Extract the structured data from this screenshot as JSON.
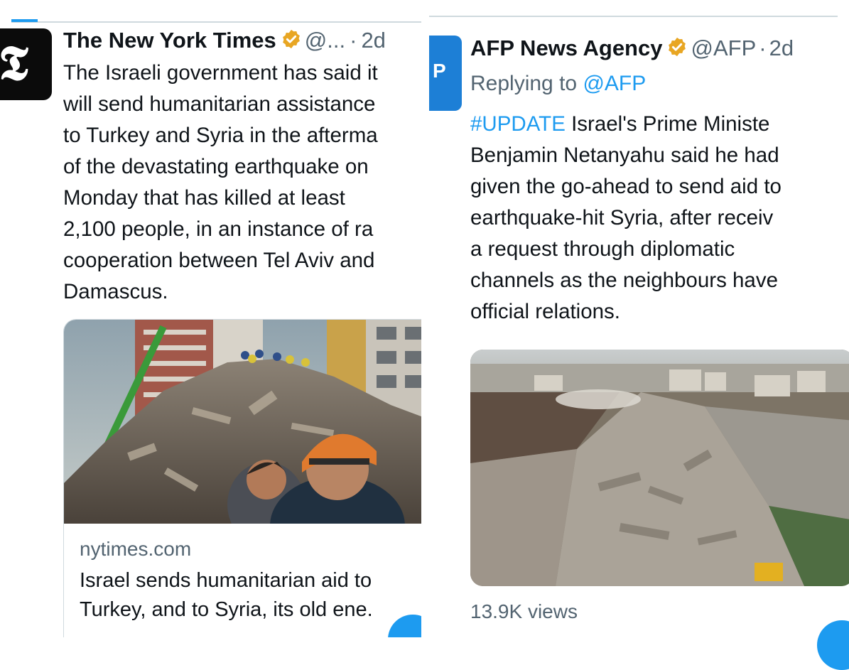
{
  "left_tweet": {
    "author_name": "The New York Times",
    "handle": "@...",
    "separator": "·",
    "time": "2d",
    "avatar_glyph": "𝕿",
    "body_lines": [
      "The Israeli government has said it",
      "will send humanitarian assistance",
      "to Turkey and Syria in the afterma",
      "of the devastating earthquake on",
      "Monday that has killed at least",
      "2,100 people, in an instance of ra",
      "cooperation between Tel Aviv and",
      "Damascus."
    ],
    "card": {
      "domain": "nytimes.com",
      "title_lines": [
        "Israel sends humanitarian aid to",
        "Turkey, and to Syria, its old ene."
      ]
    }
  },
  "right_tweet": {
    "author_name": "AFP News Agency",
    "handle": "@AFP",
    "separator": "·",
    "time": "2d",
    "avatar_glyph": "P",
    "replying_prefix": "Replying to",
    "replying_mention": "@AFP",
    "hashtag": "#UPDATE",
    "body_first_rest": " Israel's Prime Ministe",
    "body_lines": [
      "Benjamin Netanyahu said he had",
      "given the go-ahead to send aid to",
      "earthquake-hit Syria, after receiv",
      "a request through diplomatic",
      "channels as the neighbours have",
      "official relations."
    ],
    "views": "13.9K views"
  },
  "icons": {
    "verified": "verified-badge-icon",
    "nyt_avatar": "nyt-logo-icon",
    "afp_avatar": "afp-logo-icon"
  },
  "colors": {
    "accent": "#1d9bf0",
    "verified_gold": "#e8a623",
    "text": "#0f1419",
    "muted": "#536471"
  }
}
